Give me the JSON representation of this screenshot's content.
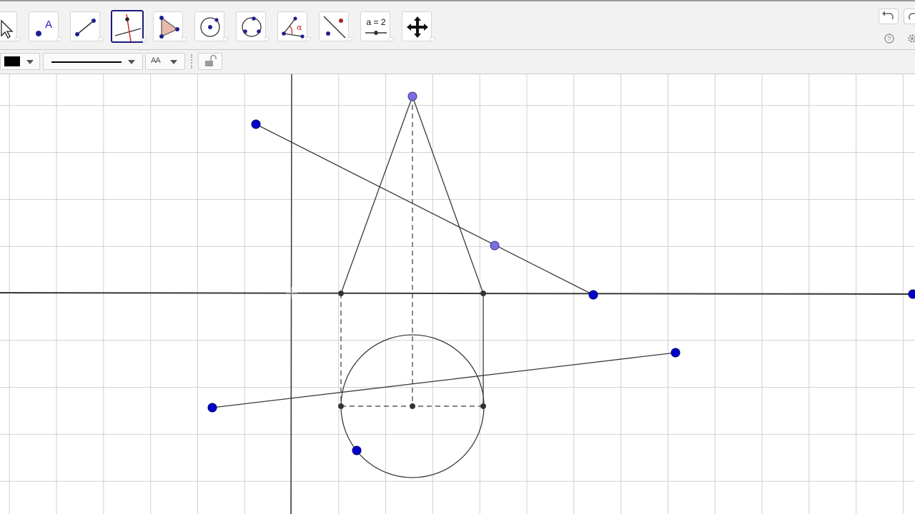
{
  "toolbar": {
    "tools": [
      {
        "name": "move",
        "icon": "pointer-arrow-icon"
      },
      {
        "name": "point",
        "icon": "point-icon",
        "label": "A"
      },
      {
        "name": "line",
        "icon": "line-icon"
      },
      {
        "name": "perpendicular-line",
        "icon": "perpendicular-line-icon",
        "selected": true
      },
      {
        "name": "polygon",
        "icon": "polygon-icon"
      },
      {
        "name": "circle-center-point",
        "icon": "circle-center-point-icon"
      },
      {
        "name": "circle-three-points",
        "icon": "circle-three-points-icon"
      },
      {
        "name": "angle",
        "icon": "angle-icon",
        "label": "α"
      },
      {
        "name": "reflect",
        "icon": "reflect-icon"
      },
      {
        "name": "slider",
        "icon": "slider-icon",
        "label": "a = 2"
      },
      {
        "name": "move-graphics",
        "icon": "move-graphics-icon"
      }
    ],
    "undo_icon": "undo-icon",
    "redo_icon": "redo-icon",
    "help_icon": "help-icon",
    "settings_icon": "gear-icon"
  },
  "stylebar": {
    "color": "#000000",
    "line_style": "solid",
    "text_size_label": "AA",
    "lock_icon": "unlocked-padlock-icon"
  },
  "colors": {
    "free_point": "#0000cc",
    "dependent_point": "#7b6fe0",
    "aux_point": "#333333",
    "grid": "#d0d0d0",
    "axes": "#3a3a3a"
  },
  "canvas": {
    "grid_on": true,
    "axes_on": true
  }
}
